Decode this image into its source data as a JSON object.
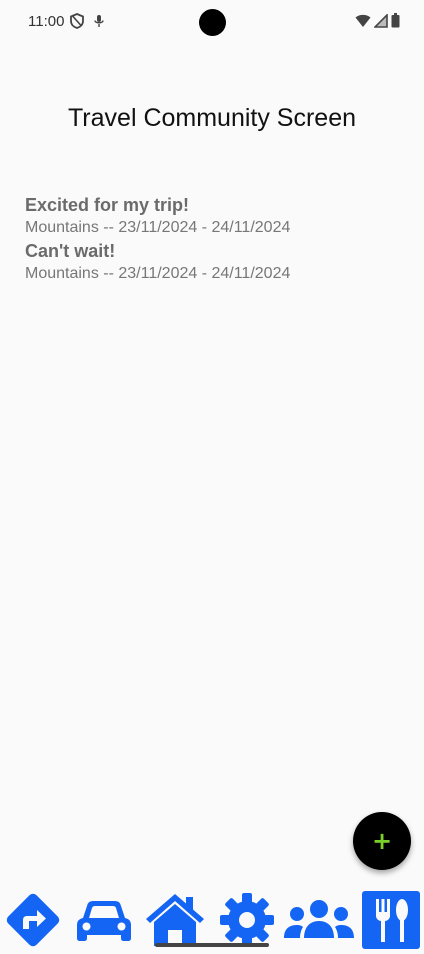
{
  "status_bar": {
    "time": "11:00",
    "left_icons": [
      "shield-icon",
      "mic-icon"
    ],
    "right_icons": [
      "wifi-icon",
      "signal-icon",
      "battery-icon"
    ]
  },
  "page": {
    "title": "Travel Community Screen"
  },
  "posts": [
    {
      "title": "Excited for my trip!",
      "meta": "Mountains -- 23/11/2024 - 24/11/2024"
    },
    {
      "title": "Can't wait!",
      "meta": "Mountains -- 23/11/2024 - 24/11/2024"
    }
  ],
  "fab": {
    "label": "+",
    "icon": "add-icon",
    "background": "#000000",
    "foreground": "#7bd12b"
  },
  "bottom_nav": {
    "accent": "#1565f5",
    "items": [
      {
        "icon": "directions-icon"
      },
      {
        "icon": "car-icon"
      },
      {
        "icon": "home-icon"
      },
      {
        "icon": "settings-icon"
      },
      {
        "icon": "community-icon",
        "selected": true
      },
      {
        "icon": "restaurant-icon"
      }
    ]
  }
}
